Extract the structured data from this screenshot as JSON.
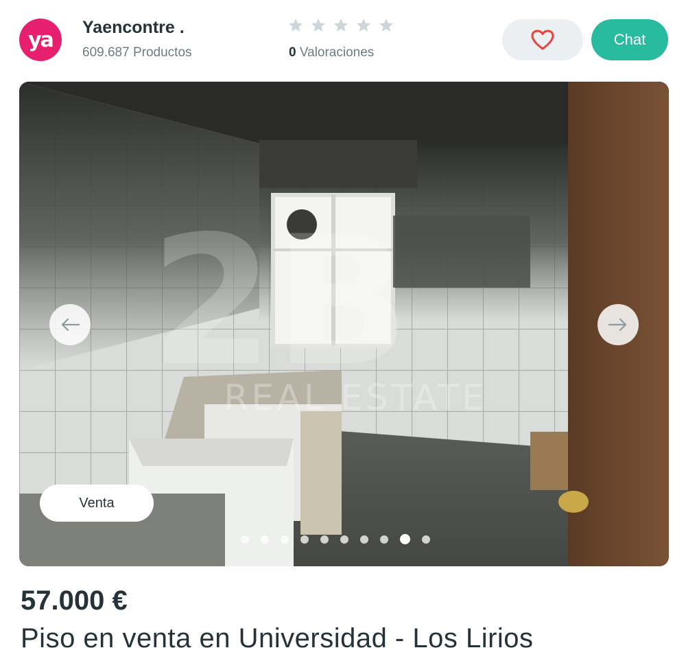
{
  "seller": {
    "avatar_text": "ya",
    "name": "Yaencontre .",
    "products": "609.687 Productos"
  },
  "rating": {
    "stars_filled": 0,
    "stars_total": 5,
    "count": "0",
    "label": "Valoraciones"
  },
  "actions": {
    "favorite_icon": "heart-icon",
    "chat_label": "Chat"
  },
  "gallery": {
    "tag": "Venta",
    "watermark_logo": "2B",
    "watermark_text": "REAL ESTATE",
    "total_images": 10,
    "active_index": 9,
    "prev_icon": "arrow-left-icon",
    "next_icon": "arrow-right-icon"
  },
  "listing": {
    "price": "57.000 €",
    "title": "Piso en venta en Universidad - Los Lirios"
  },
  "colors": {
    "brand": "#e6206e",
    "accent": "#29bba0",
    "heart": "#e8433a",
    "text": "#253238",
    "muted": "#6b7b83"
  }
}
